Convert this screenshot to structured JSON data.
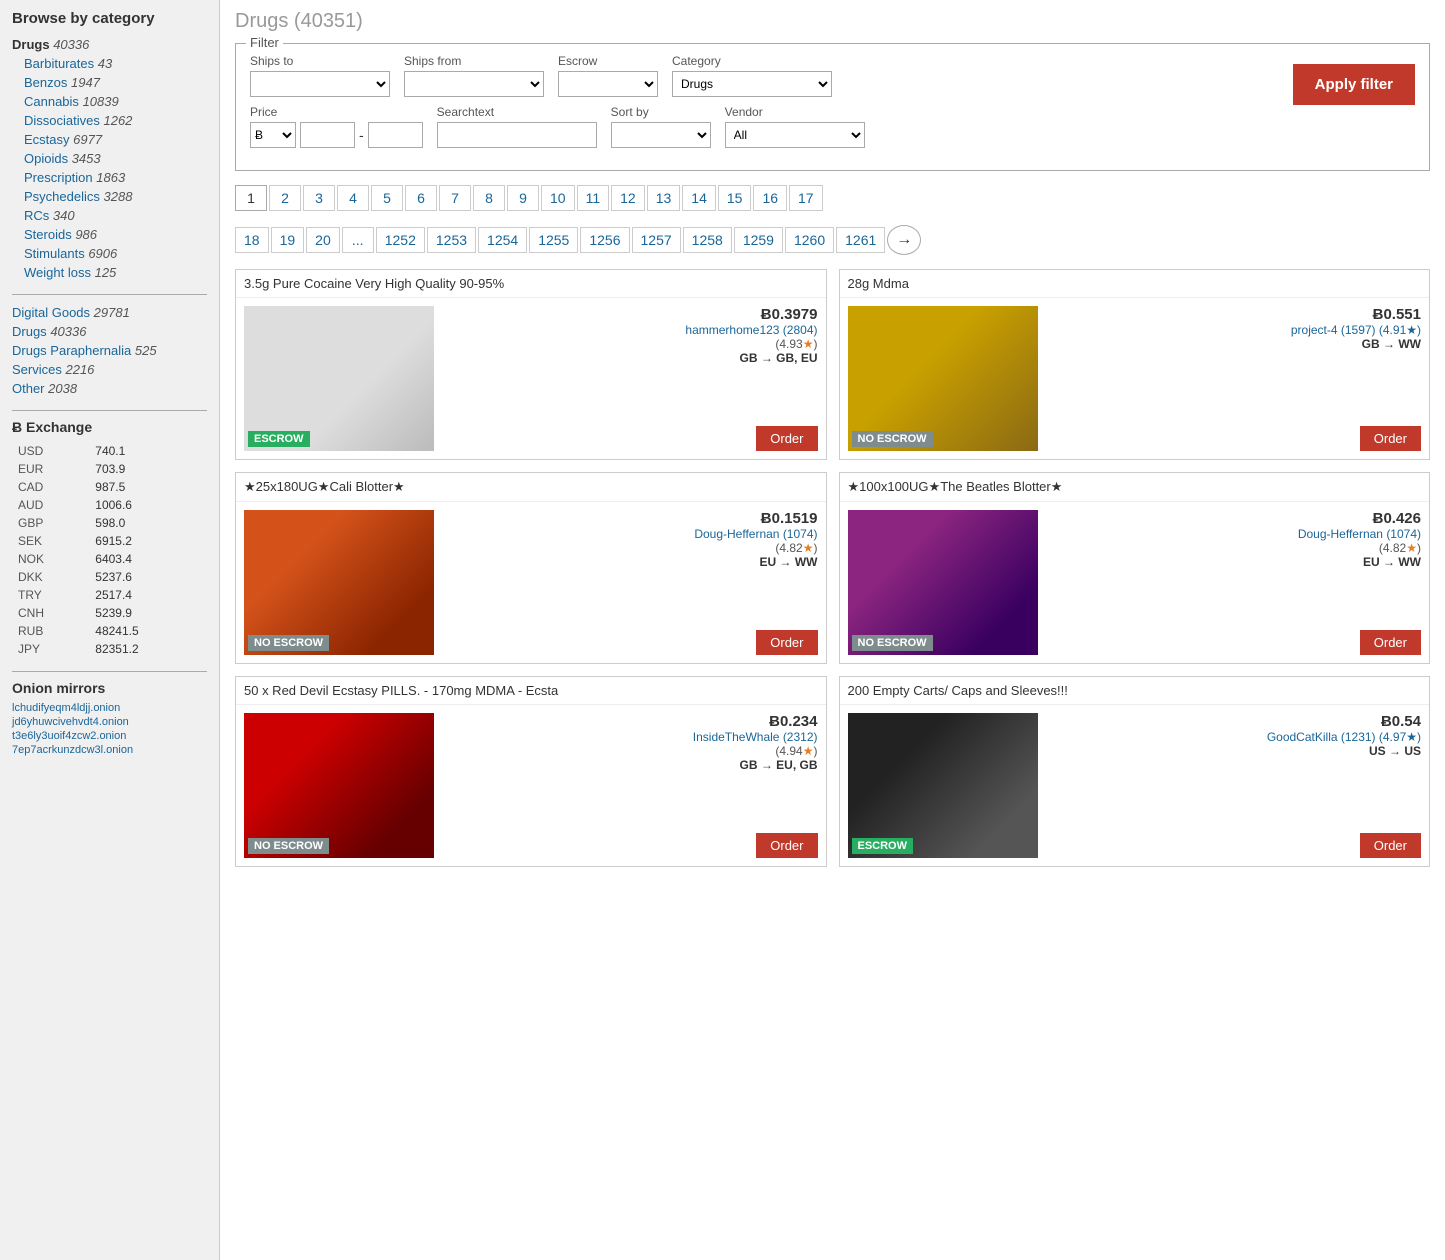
{
  "sidebar": {
    "title": "Browse by category",
    "categories": [
      {
        "label": "Drugs",
        "count": "40336",
        "active": true,
        "indent": false
      },
      {
        "label": "Barbiturates",
        "count": "43",
        "indent": true
      },
      {
        "label": "Benzos",
        "count": "1947",
        "indent": true
      },
      {
        "label": "Cannabis",
        "count": "10839",
        "indent": true
      },
      {
        "label": "Dissociatives",
        "count": "1262",
        "indent": true
      },
      {
        "label": "Ecstasy",
        "count": "6977",
        "indent": true
      },
      {
        "label": "Opioids",
        "count": "3453",
        "indent": true
      },
      {
        "label": "Prescription",
        "count": "1863",
        "indent": true
      },
      {
        "label": "Psychedelics",
        "count": "3288",
        "indent": true
      },
      {
        "label": "RCs",
        "count": "340",
        "indent": true
      },
      {
        "label": "Steroids",
        "count": "986",
        "indent": true
      },
      {
        "label": "Stimulants",
        "count": "6906",
        "indent": true
      },
      {
        "label": "Weight loss",
        "count": "125",
        "indent": true
      }
    ],
    "sections": [
      {
        "label": "Digital Goods",
        "count": "29781"
      },
      {
        "label": "Drugs",
        "count": "40336"
      },
      {
        "label": "Drugs Paraphernalia",
        "count": "525"
      },
      {
        "label": "Services",
        "count": "2216"
      },
      {
        "label": "Other",
        "count": "2038"
      }
    ],
    "exchange": {
      "title": "Ƀ Exchange",
      "rates": [
        {
          "currency": "USD",
          "value": "740.1"
        },
        {
          "currency": "EUR",
          "value": "703.9"
        },
        {
          "currency": "CAD",
          "value": "987.5"
        },
        {
          "currency": "AUD",
          "value": "1006.6"
        },
        {
          "currency": "GBP",
          "value": "598.0"
        },
        {
          "currency": "SEK",
          "value": "6915.2"
        },
        {
          "currency": "NOK",
          "value": "6403.4"
        },
        {
          "currency": "DKK",
          "value": "5237.6"
        },
        {
          "currency": "TRY",
          "value": "2517.4"
        },
        {
          "currency": "CNH",
          "value": "5239.9"
        },
        {
          "currency": "RUB",
          "value": "48241.5"
        },
        {
          "currency": "JPY",
          "value": "82351.2"
        }
      ]
    },
    "onion": {
      "title": "Onion mirrors",
      "links": [
        "lchudifyeqm4ldjj.onion",
        "jd6yhuwcivehvdt4.onion",
        "t3e6ly3uoif4zcw2.onion",
        "7ep7acrkunzdcw3l.onion"
      ]
    }
  },
  "main": {
    "page_title": "Drugs (40351)",
    "filter": {
      "legend": "Filter",
      "ships_to_label": "Ships to",
      "ships_from_label": "Ships from",
      "escrow_label": "Escrow",
      "category_label": "Category",
      "category_value": "Drugs",
      "price_label": "Price",
      "searchtext_label": "Searchtext",
      "sort_by_label": "Sort by",
      "vendor_label": "Vendor",
      "vendor_value": "All",
      "apply_button": "Apply filter"
    },
    "pagination_row1": [
      "1",
      "2",
      "3",
      "4",
      "5",
      "6",
      "7",
      "8",
      "9",
      "10",
      "11",
      "12",
      "13",
      "14",
      "15",
      "16",
      "17"
    ],
    "pagination_row2": [
      "18",
      "19",
      "20",
      "...",
      "1252",
      "1253",
      "1254",
      "1255",
      "1256",
      "1257",
      "1258",
      "1259",
      "1260",
      "1261"
    ],
    "products": [
      {
        "title": "3.5g Pure Cocaine Very High Quality 90-95%",
        "price": "Ƀ0.3979",
        "vendor": "hammerhome123 (2804)",
        "rating": "(4.93★)",
        "shipping": "GB → GB, EU",
        "escrow": "ESCROW",
        "escrow_type": "escrow",
        "img_class": "img-cocaine"
      },
      {
        "title": "28g Mdma",
        "price": "Ƀ0.551",
        "vendor": "project-4 (1597) (4.91★)",
        "rating": "",
        "shipping": "GB → WW",
        "escrow": "NO ESCROW",
        "escrow_type": "no-escrow",
        "img_class": "img-mdma"
      },
      {
        "title": "★25x180UG★Cali Blotter★",
        "price": "Ƀ0.1519",
        "vendor": "Doug-Heffernan (1074)",
        "rating": "(4.82★)",
        "shipping": "EU → WW",
        "escrow": "NO ESCROW",
        "escrow_type": "no-escrow",
        "img_class": "img-blotter1"
      },
      {
        "title": "★100x100UG★The Beatles Blotter★",
        "price": "Ƀ0.426",
        "vendor": "Doug-Heffernan (1074)",
        "rating": "(4.82★)",
        "shipping": "EU → WW",
        "escrow": "NO ESCROW",
        "escrow_type": "no-escrow",
        "img_class": "img-blotter2"
      },
      {
        "title": "50 x Red Devil Ecstasy PILLS. - 170mg MDMA - Ecsta",
        "price": "Ƀ0.234",
        "vendor": "InsideTheWhale (2312)",
        "rating": "(4.94★)",
        "shipping": "GB → EU, GB",
        "escrow": "NO ESCROW",
        "escrow_type": "no-escrow",
        "img_class": "img-ecstasy"
      },
      {
        "title": "200 Empty Carts/ Caps and Sleeves!!!",
        "price": "Ƀ0.54",
        "vendor": "GoodCatKilla (1231) (4.97★)",
        "rating": "",
        "shipping": "US → US",
        "escrow": "ESCROW",
        "escrow_type": "escrow",
        "img_class": "img-carts"
      }
    ]
  }
}
